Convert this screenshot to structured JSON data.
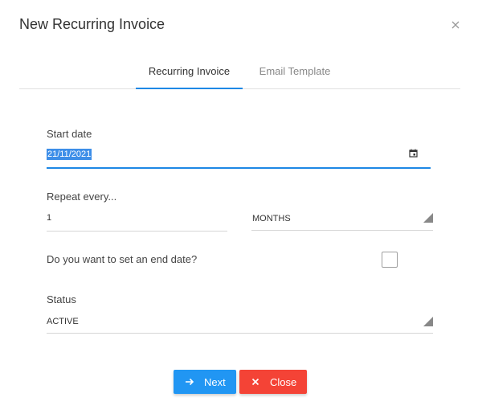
{
  "dialog": {
    "title": "New Recurring Invoice",
    "close_icon": "close-icon"
  },
  "tabs": [
    {
      "label": "Recurring Invoice",
      "active": true
    },
    {
      "label": "Email Template",
      "active": false
    }
  ],
  "form": {
    "start_date": {
      "label": "Start date",
      "value": "21/11/2021",
      "icon": "calendar-icon"
    },
    "repeat": {
      "label": "Repeat every...",
      "count": "1",
      "unit": "MONTHS"
    },
    "end_date": {
      "label": "Do you want to set an end date?",
      "checked": false
    },
    "status": {
      "label": "Status",
      "value": "ACTIVE"
    }
  },
  "buttons": {
    "next": {
      "label": "Next",
      "icon": "arrow-right-icon"
    },
    "close": {
      "label": "Close",
      "icon": "close-icon"
    }
  },
  "colors": {
    "accent": "#1e88e5",
    "next_button": "#2196f3",
    "close_button": "#f44336"
  }
}
